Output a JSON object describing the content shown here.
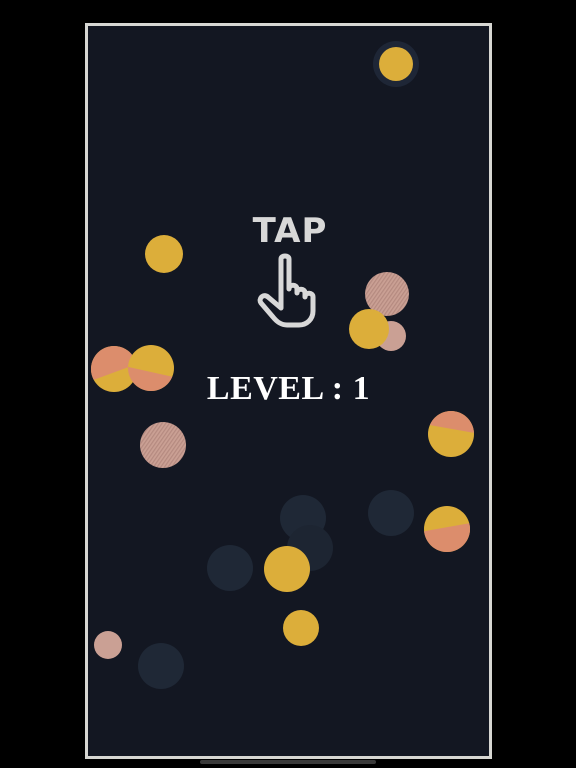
{
  "hud": {
    "tap_label": "TAP",
    "level_label": "LEVEL",
    "level_separator": " : ",
    "level_value": "1"
  },
  "icons": {
    "tap_hint": "pointing-hand-icon"
  },
  "colors": {
    "background": "#131722",
    "frame_border": "#d7d7d3",
    "gold": "#dcae3a",
    "salmon": "#dc8d6c",
    "pink": "#caa094",
    "shadow_dot": "#1f2836",
    "text": "#ffffff",
    "hint": "#d8d8d8"
  },
  "orbs": [
    {
      "kind": "gold-ringed"
    },
    {
      "kind": "gold"
    },
    {
      "kind": "striped-pink"
    },
    {
      "kind": "gold"
    },
    {
      "kind": "pink-small"
    },
    {
      "kind": "salmon-gold"
    },
    {
      "kind": "gold-salmon"
    },
    {
      "kind": "striped-pink"
    },
    {
      "kind": "gold-salmon"
    },
    {
      "kind": "gold-salmon"
    },
    {
      "kind": "shadow"
    },
    {
      "kind": "shadow"
    },
    {
      "kind": "shadow"
    },
    {
      "kind": "shadow"
    },
    {
      "kind": "gold"
    },
    {
      "kind": "gold"
    },
    {
      "kind": "pink-small"
    },
    {
      "kind": "shadow"
    }
  ]
}
